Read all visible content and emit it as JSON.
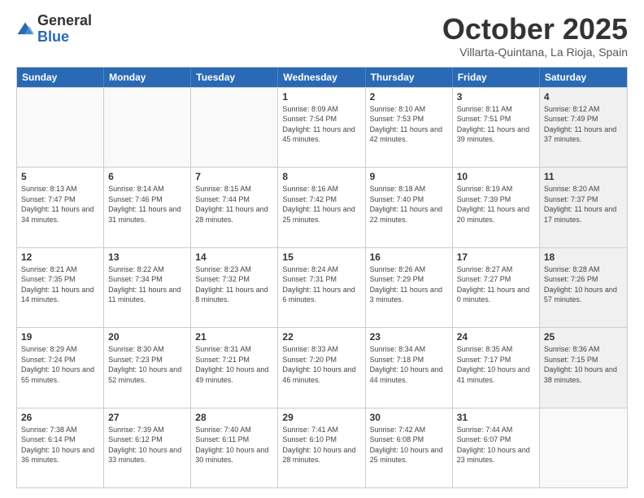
{
  "logo": {
    "general": "General",
    "blue": "Blue"
  },
  "header": {
    "month": "October 2025",
    "location": "Villarta-Quintana, La Rioja, Spain"
  },
  "days_of_week": [
    "Sunday",
    "Monday",
    "Tuesday",
    "Wednesday",
    "Thursday",
    "Friday",
    "Saturday"
  ],
  "rows": [
    [
      {
        "day": "",
        "info": "",
        "shaded": false,
        "empty": true
      },
      {
        "day": "",
        "info": "",
        "shaded": false,
        "empty": true
      },
      {
        "day": "",
        "info": "",
        "shaded": false,
        "empty": true
      },
      {
        "day": "1",
        "info": "Sunrise: 8:09 AM\nSunset: 7:54 PM\nDaylight: 11 hours and 45 minutes.",
        "shaded": false,
        "empty": false
      },
      {
        "day": "2",
        "info": "Sunrise: 8:10 AM\nSunset: 7:53 PM\nDaylight: 11 hours and 42 minutes.",
        "shaded": false,
        "empty": false
      },
      {
        "day": "3",
        "info": "Sunrise: 8:11 AM\nSunset: 7:51 PM\nDaylight: 11 hours and 39 minutes.",
        "shaded": false,
        "empty": false
      },
      {
        "day": "4",
        "info": "Sunrise: 8:12 AM\nSunset: 7:49 PM\nDaylight: 11 hours and 37 minutes.",
        "shaded": true,
        "empty": false
      }
    ],
    [
      {
        "day": "5",
        "info": "Sunrise: 8:13 AM\nSunset: 7:47 PM\nDaylight: 11 hours and 34 minutes.",
        "shaded": false,
        "empty": false
      },
      {
        "day": "6",
        "info": "Sunrise: 8:14 AM\nSunset: 7:46 PM\nDaylight: 11 hours and 31 minutes.",
        "shaded": false,
        "empty": false
      },
      {
        "day": "7",
        "info": "Sunrise: 8:15 AM\nSunset: 7:44 PM\nDaylight: 11 hours and 28 minutes.",
        "shaded": false,
        "empty": false
      },
      {
        "day": "8",
        "info": "Sunrise: 8:16 AM\nSunset: 7:42 PM\nDaylight: 11 hours and 25 minutes.",
        "shaded": false,
        "empty": false
      },
      {
        "day": "9",
        "info": "Sunrise: 8:18 AM\nSunset: 7:40 PM\nDaylight: 11 hours and 22 minutes.",
        "shaded": false,
        "empty": false
      },
      {
        "day": "10",
        "info": "Sunrise: 8:19 AM\nSunset: 7:39 PM\nDaylight: 11 hours and 20 minutes.",
        "shaded": false,
        "empty": false
      },
      {
        "day": "11",
        "info": "Sunrise: 8:20 AM\nSunset: 7:37 PM\nDaylight: 11 hours and 17 minutes.",
        "shaded": true,
        "empty": false
      }
    ],
    [
      {
        "day": "12",
        "info": "Sunrise: 8:21 AM\nSunset: 7:35 PM\nDaylight: 11 hours and 14 minutes.",
        "shaded": false,
        "empty": false
      },
      {
        "day": "13",
        "info": "Sunrise: 8:22 AM\nSunset: 7:34 PM\nDaylight: 11 hours and 11 minutes.",
        "shaded": false,
        "empty": false
      },
      {
        "day": "14",
        "info": "Sunrise: 8:23 AM\nSunset: 7:32 PM\nDaylight: 11 hours and 8 minutes.",
        "shaded": false,
        "empty": false
      },
      {
        "day": "15",
        "info": "Sunrise: 8:24 AM\nSunset: 7:31 PM\nDaylight: 11 hours and 6 minutes.",
        "shaded": false,
        "empty": false
      },
      {
        "day": "16",
        "info": "Sunrise: 8:26 AM\nSunset: 7:29 PM\nDaylight: 11 hours and 3 minutes.",
        "shaded": false,
        "empty": false
      },
      {
        "day": "17",
        "info": "Sunrise: 8:27 AM\nSunset: 7:27 PM\nDaylight: 11 hours and 0 minutes.",
        "shaded": false,
        "empty": false
      },
      {
        "day": "18",
        "info": "Sunrise: 8:28 AM\nSunset: 7:26 PM\nDaylight: 10 hours and 57 minutes.",
        "shaded": true,
        "empty": false
      }
    ],
    [
      {
        "day": "19",
        "info": "Sunrise: 8:29 AM\nSunset: 7:24 PM\nDaylight: 10 hours and 55 minutes.",
        "shaded": false,
        "empty": false
      },
      {
        "day": "20",
        "info": "Sunrise: 8:30 AM\nSunset: 7:23 PM\nDaylight: 10 hours and 52 minutes.",
        "shaded": false,
        "empty": false
      },
      {
        "day": "21",
        "info": "Sunrise: 8:31 AM\nSunset: 7:21 PM\nDaylight: 10 hours and 49 minutes.",
        "shaded": false,
        "empty": false
      },
      {
        "day": "22",
        "info": "Sunrise: 8:33 AM\nSunset: 7:20 PM\nDaylight: 10 hours and 46 minutes.",
        "shaded": false,
        "empty": false
      },
      {
        "day": "23",
        "info": "Sunrise: 8:34 AM\nSunset: 7:18 PM\nDaylight: 10 hours and 44 minutes.",
        "shaded": false,
        "empty": false
      },
      {
        "day": "24",
        "info": "Sunrise: 8:35 AM\nSunset: 7:17 PM\nDaylight: 10 hours and 41 minutes.",
        "shaded": false,
        "empty": false
      },
      {
        "day": "25",
        "info": "Sunrise: 8:36 AM\nSunset: 7:15 PM\nDaylight: 10 hours and 38 minutes.",
        "shaded": true,
        "empty": false
      }
    ],
    [
      {
        "day": "26",
        "info": "Sunrise: 7:38 AM\nSunset: 6:14 PM\nDaylight: 10 hours and 36 minutes.",
        "shaded": false,
        "empty": false
      },
      {
        "day": "27",
        "info": "Sunrise: 7:39 AM\nSunset: 6:12 PM\nDaylight: 10 hours and 33 minutes.",
        "shaded": false,
        "empty": false
      },
      {
        "day": "28",
        "info": "Sunrise: 7:40 AM\nSunset: 6:11 PM\nDaylight: 10 hours and 30 minutes.",
        "shaded": false,
        "empty": false
      },
      {
        "day": "29",
        "info": "Sunrise: 7:41 AM\nSunset: 6:10 PM\nDaylight: 10 hours and 28 minutes.",
        "shaded": false,
        "empty": false
      },
      {
        "day": "30",
        "info": "Sunrise: 7:42 AM\nSunset: 6:08 PM\nDaylight: 10 hours and 25 minutes.",
        "shaded": false,
        "empty": false
      },
      {
        "day": "31",
        "info": "Sunrise: 7:44 AM\nSunset: 6:07 PM\nDaylight: 10 hours and 23 minutes.",
        "shaded": false,
        "empty": false
      },
      {
        "day": "",
        "info": "",
        "shaded": true,
        "empty": true
      }
    ]
  ]
}
